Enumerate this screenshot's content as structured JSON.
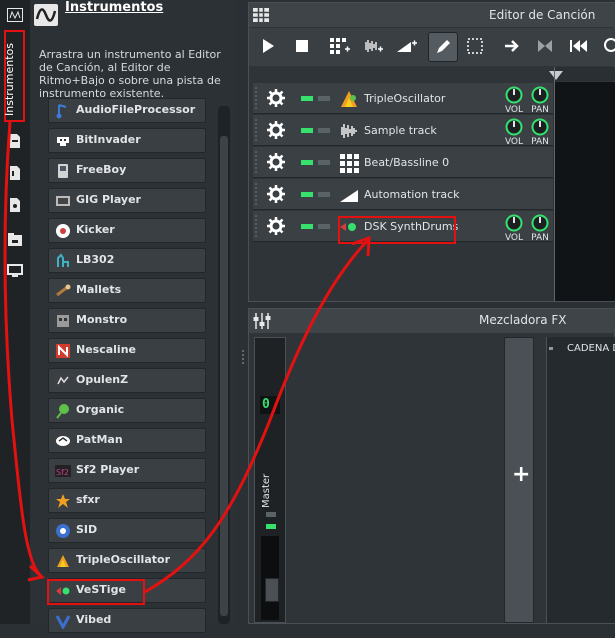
{
  "left_tabs": {
    "active_tab_label": "Instrumentos",
    "icons": [
      "instrument-plugin-icon",
      "project-file-icon",
      "sample-file-icon",
      "preset-file-icon",
      "home-folder-icon",
      "computer-icon"
    ]
  },
  "browser": {
    "title": "Instrumentos",
    "description": "Arrastra un instrumento al Editor de Canción, al Editor de Ritmo+Bajo o sobre una pista de instrumento existente.",
    "instruments": [
      {
        "label": "AudioFileProcessor",
        "icon": "audiofileprocessor-icon",
        "color": "#3c7cd8"
      },
      {
        "label": "BitInvader",
        "icon": "bitinvader-icon",
        "color": "#ffffff"
      },
      {
        "label": "FreeBoy",
        "icon": "freeboy-icon",
        "color": "#cfd4d6"
      },
      {
        "label": "GIG Player",
        "icon": "gig-player-icon",
        "color": "#444444"
      },
      {
        "label": "Kicker",
        "icon": "kicker-icon",
        "color": "#d43d3d"
      },
      {
        "label": "LB302",
        "icon": "lb302-icon",
        "color": "#3fb2c7"
      },
      {
        "label": "Mallets",
        "icon": "mallets-icon",
        "color": "#b07a3a"
      },
      {
        "label": "Monstro",
        "icon": "monstro-icon",
        "color": "#9a9a9a"
      },
      {
        "label": "Nescaline",
        "icon": "nescaline-icon",
        "color": "#d23b2d"
      },
      {
        "label": "OpulenZ",
        "icon": "opulenz-icon",
        "color": "#3c4044"
      },
      {
        "label": "Organic",
        "icon": "organic-icon",
        "color": "#5fc04a"
      },
      {
        "label": "PatMan",
        "icon": "patman-icon",
        "color": "#ffffff"
      },
      {
        "label": "Sf2 Player",
        "icon": "sf2-player-icon",
        "color": "#c23b8a"
      },
      {
        "label": "sfxr",
        "icon": "sfxr-icon",
        "color": "#f0a020"
      },
      {
        "label": "SID",
        "icon": "sid-icon",
        "color": "#3b6fd0"
      },
      {
        "label": "TripleOscillator",
        "icon": "tripleoscillator-icon",
        "color": "#f0a020"
      },
      {
        "label": "VeSTige",
        "icon": "vestige-icon",
        "color": "#35e06d"
      },
      {
        "label": "Vibed",
        "icon": "vibed-icon",
        "color": "#3b6fd0"
      }
    ]
  },
  "song_editor": {
    "title": "Editor de Canción",
    "toolbar_icons": [
      "play-icon",
      "stop-icon",
      "add-beat-bassline-icon",
      "add-sample-track-icon",
      "add-automation-track-icon",
      "draw-mode-icon",
      "select-mode-icon",
      "arrow-icon",
      "bowtie-icon",
      "rewind-icon",
      "zoom-icon"
    ],
    "tracks": [
      {
        "name": "TripleOscillator",
        "icon": "tripleoscillator-icon",
        "knobs": true
      },
      {
        "name": "Sample track",
        "icon": "sample-track-icon",
        "knobs": true
      },
      {
        "name": "Beat/Bassline 0",
        "icon": "beat-bassline-icon",
        "knobs": false
      },
      {
        "name": "Automation track",
        "icon": "automation-track-icon",
        "knobs": false
      },
      {
        "name": "DSK SynthDrums",
        "icon": "dsk-synthdrums-icon",
        "knobs": true
      }
    ],
    "knob_labels": {
      "vol": "VOL",
      "pan": "PAN"
    }
  },
  "fx_mixer": {
    "title": "Mezcladora FX",
    "master_lcd": "0",
    "master_label": "Master",
    "add_button": "+",
    "chain_label": "CADENA D"
  },
  "colors": {
    "accent_green": "#35e06d",
    "annotation_red": "#e41111",
    "panel_bg": "#2c3135"
  }
}
